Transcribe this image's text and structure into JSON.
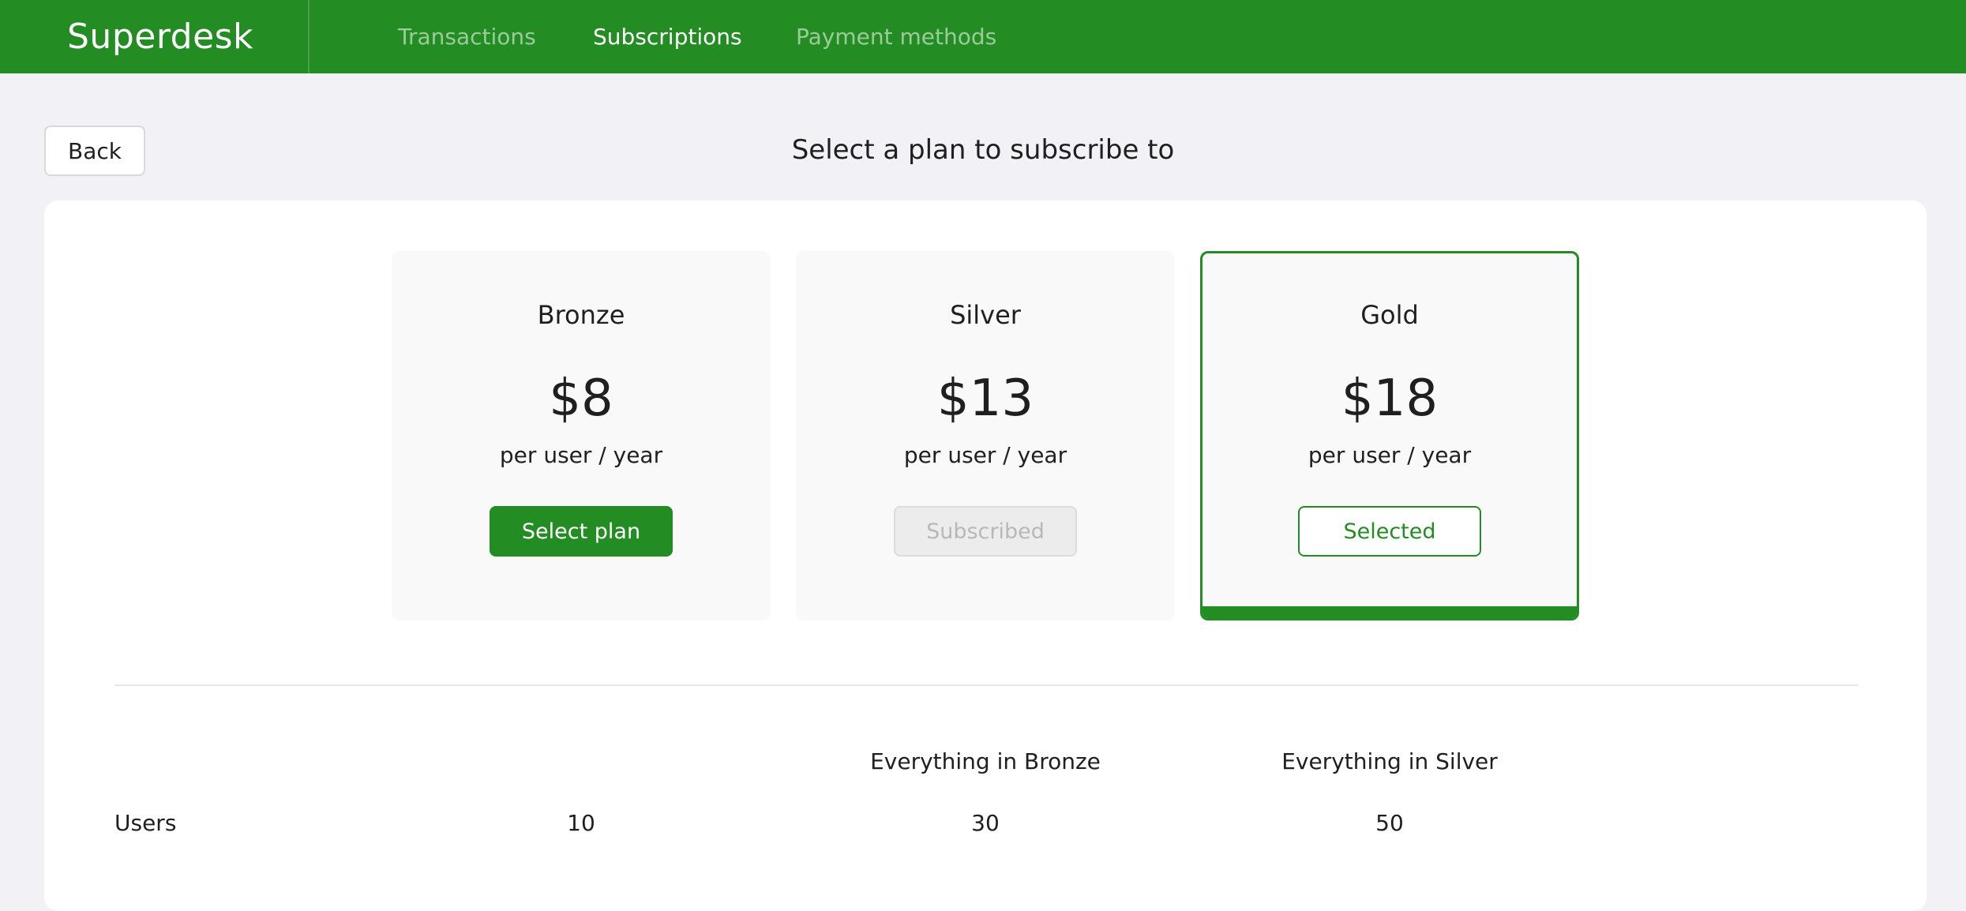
{
  "header": {
    "brand": "Superdesk",
    "nav": [
      {
        "label": "Transactions",
        "active": false
      },
      {
        "label": "Subscriptions",
        "active": true
      },
      {
        "label": "Payment methods",
        "active": false
      }
    ]
  },
  "back_label": "Back",
  "page_title": "Select a plan to subscribe to",
  "plans": [
    {
      "name": "Bronze",
      "price": "$8",
      "period": "per user / year",
      "button": "Select plan",
      "state": "available"
    },
    {
      "name": "Silver",
      "price": "$13",
      "period": "per user / year",
      "button": "Subscribed",
      "state": "subscribed"
    },
    {
      "name": "Gold",
      "price": "$18",
      "period": "per user / year",
      "button": "Selected",
      "state": "selected"
    }
  ],
  "features": {
    "includes": [
      "",
      "Everything in Bronze",
      "Everything in Silver"
    ],
    "rows": [
      {
        "label": "Users",
        "values": [
          "10",
          "30",
          "50"
        ]
      }
    ]
  },
  "colors": {
    "brand_green": "#238c23",
    "page_bg": "#f2f2f6",
    "card_bg": "#f9f9f9"
  }
}
